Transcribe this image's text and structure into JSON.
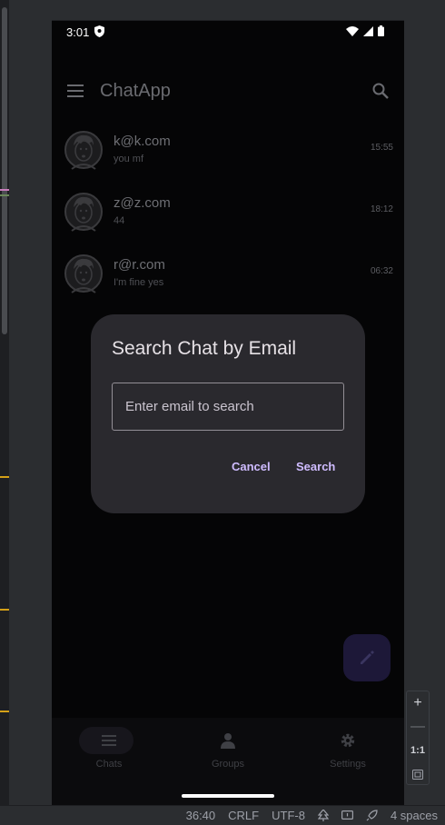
{
  "android_status": {
    "time": "3:01"
  },
  "appbar": {
    "title": "ChatApp"
  },
  "chats": [
    {
      "name": "k@k.com",
      "message": "you mf",
      "time": "15:55"
    },
    {
      "name": "z@z.com",
      "message": "44",
      "time": "18:12"
    },
    {
      "name": "r@r.com",
      "message": "I'm fine yes",
      "time": "06:32"
    }
  ],
  "dialog": {
    "title": "Search Chat by Email",
    "input_placeholder": "Enter email to search",
    "input_value": "",
    "cancel_label": "Cancel",
    "search_label": "Search"
  },
  "bottom_nav": {
    "items": [
      {
        "label": "Chats",
        "icon": "chats-icon"
      },
      {
        "label": "Groups",
        "icon": "person-icon"
      },
      {
        "label": "Settings",
        "icon": "gear-icon"
      }
    ]
  },
  "ide_zoom": {
    "plus": "+",
    "minus": "—",
    "actual": "1:1"
  },
  "ide_status": {
    "position": "36:40",
    "line_ending": "CRLF",
    "encoding": "UTF-8",
    "indent": "4 spaces"
  },
  "colors": {
    "accent": "#cfbcff",
    "dialog_bg": "#2a292e",
    "fab_bg": "#1d1838"
  }
}
